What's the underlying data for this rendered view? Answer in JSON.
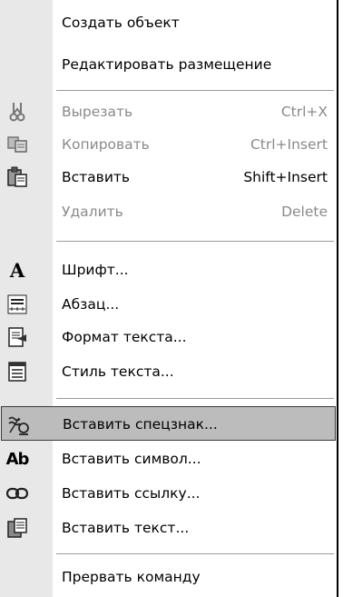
{
  "menu": {
    "items": [
      {
        "label": "Создать объект",
        "shortcut": "",
        "icon": "",
        "disabled": false
      },
      {
        "label": "Редактировать размещение",
        "shortcut": "",
        "icon": "",
        "disabled": false
      },
      {
        "label": "Вырезать",
        "shortcut": "Ctrl+X",
        "icon": "scissors-icon",
        "disabled": true
      },
      {
        "label": "Копировать",
        "shortcut": "Ctrl+Insert",
        "icon": "copy-icon",
        "disabled": true
      },
      {
        "label": "Вставить",
        "shortcut": "Shift+Insert",
        "icon": "paste-icon",
        "disabled": false
      },
      {
        "label": "Удалить",
        "shortcut": "Delete",
        "icon": "",
        "disabled": true
      },
      {
        "label": "Шрифт...",
        "shortcut": "",
        "icon": "font-icon",
        "disabled": false
      },
      {
        "label": "Абзац...",
        "shortcut": "",
        "icon": "paragraph-icon",
        "disabled": false
      },
      {
        "label": "Формат текста...",
        "shortcut": "",
        "icon": "text-format-icon",
        "disabled": false
      },
      {
        "label": "Стиль текста...",
        "shortcut": "",
        "icon": "text-style-icon",
        "disabled": false
      },
      {
        "label": "Вставить спецзнак...",
        "shortcut": "",
        "icon": "special-char-icon",
        "disabled": false,
        "highlighted": true
      },
      {
        "label": "Вставить символ...",
        "shortcut": "",
        "icon": "symbol-icon",
        "disabled": false
      },
      {
        "label": "Вставить ссылку...",
        "shortcut": "",
        "icon": "link-icon",
        "disabled": false
      },
      {
        "label": "Вставить текст...",
        "shortcut": "",
        "icon": "insert-text-icon",
        "disabled": false
      },
      {
        "label": "Прервать команду",
        "shortcut": "",
        "icon": "",
        "disabled": false
      }
    ],
    "icon_glyphs": {
      "font": "A",
      "symbol": "Ab"
    },
    "colors": {
      "disabled_text": "#8a8a8a",
      "highlight_bg": "#bcbcbc",
      "gutter": "#e8e8e8"
    }
  }
}
